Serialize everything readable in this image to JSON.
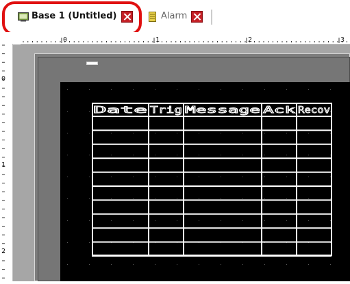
{
  "tabs": [
    {
      "label": "Base 1 (Untitled)",
      "icon": "screen-icon",
      "active": true
    },
    {
      "label": "Alarm",
      "icon": "alarm-screen-icon",
      "active": false
    }
  ],
  "ruler": {
    "horizontal_marks": [
      "0",
      "1",
      "2",
      "3"
    ],
    "vertical_marks": [
      "0",
      "1",
      "2"
    ]
  },
  "alarm_table": {
    "columns": [
      "Date",
      "Trig",
      "Message",
      "Ack",
      "Recov"
    ],
    "empty_rows": 10
  },
  "colors": {
    "highlight": "#e01010",
    "close_button": "#c41f25",
    "canvas": "#000000",
    "workarea": "#a6a6a6"
  }
}
